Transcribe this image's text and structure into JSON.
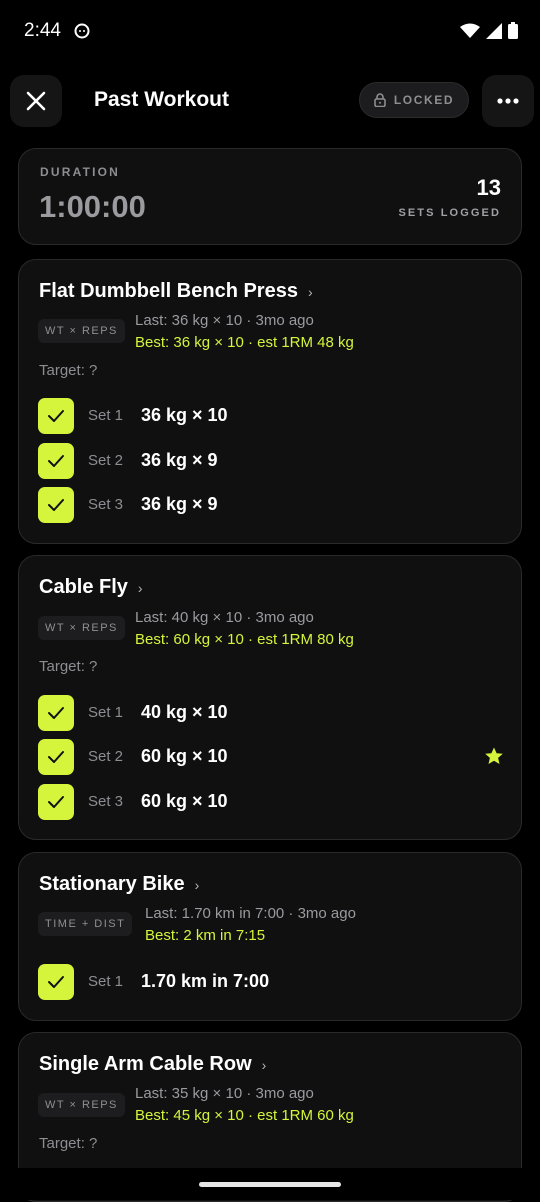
{
  "status_bar": {
    "time": "2:44"
  },
  "header": {
    "title": "Past Workout",
    "locked_label": "LOCKED"
  },
  "summary": {
    "duration_label": "DURATION",
    "duration_value": "1:00:00",
    "sets_count": "13",
    "sets_label": "SETS LOGGED"
  },
  "exercises": [
    {
      "name": "Flat Dumbbell Bench Press",
      "badge": "WT × REPS",
      "last": "Last: 36 kg × 10 · 3mo ago",
      "best": "Best: 36 kg × 10  ·  est 1RM 48 kg",
      "target": "Target: ?",
      "sets": [
        {
          "label": "Set 1",
          "value": "36 kg × 10"
        },
        {
          "label": "Set 2",
          "value": "36 kg × 9"
        },
        {
          "label": "Set 3",
          "value": "36 kg × 9"
        }
      ]
    },
    {
      "name": "Cable Fly",
      "badge": "WT × REPS",
      "last": "Last: 40 kg × 10 · 3mo ago",
      "best": "Best: 60 kg × 10  ·  est 1RM 80 kg",
      "target": "Target: ?",
      "sets": [
        {
          "label": "Set 1",
          "value": "40 kg × 10"
        },
        {
          "label": "Set 2",
          "value": "60 kg × 10",
          "starred": true
        },
        {
          "label": "Set 3",
          "value": "60 kg × 10"
        }
      ]
    },
    {
      "name": "Stationary Bike",
      "badge": "TIME + DIST",
      "last": "Last: 1.70 km in 7:00 · 3mo ago",
      "best": "Best: 2 km in 7:15",
      "sets": [
        {
          "label": "Set 1",
          "value": "1.70 km in 7:00"
        }
      ]
    },
    {
      "name": "Single Arm Cable Row",
      "badge": "WT × REPS",
      "last": "Last: 35 kg × 10 · 3mo ago",
      "best": "Best: 45 kg × 10  ·  est 1RM 60 kg",
      "target": "Target: ?"
    }
  ],
  "icons": {
    "close": "close-icon",
    "more": "more-icon",
    "lock": "lock-icon",
    "check": "check-icon",
    "star": "star-icon",
    "chevron": "chevron-right-icon"
  },
  "colors": {
    "accent": "#d4f53c",
    "background": "#000000",
    "card": "#101011"
  }
}
